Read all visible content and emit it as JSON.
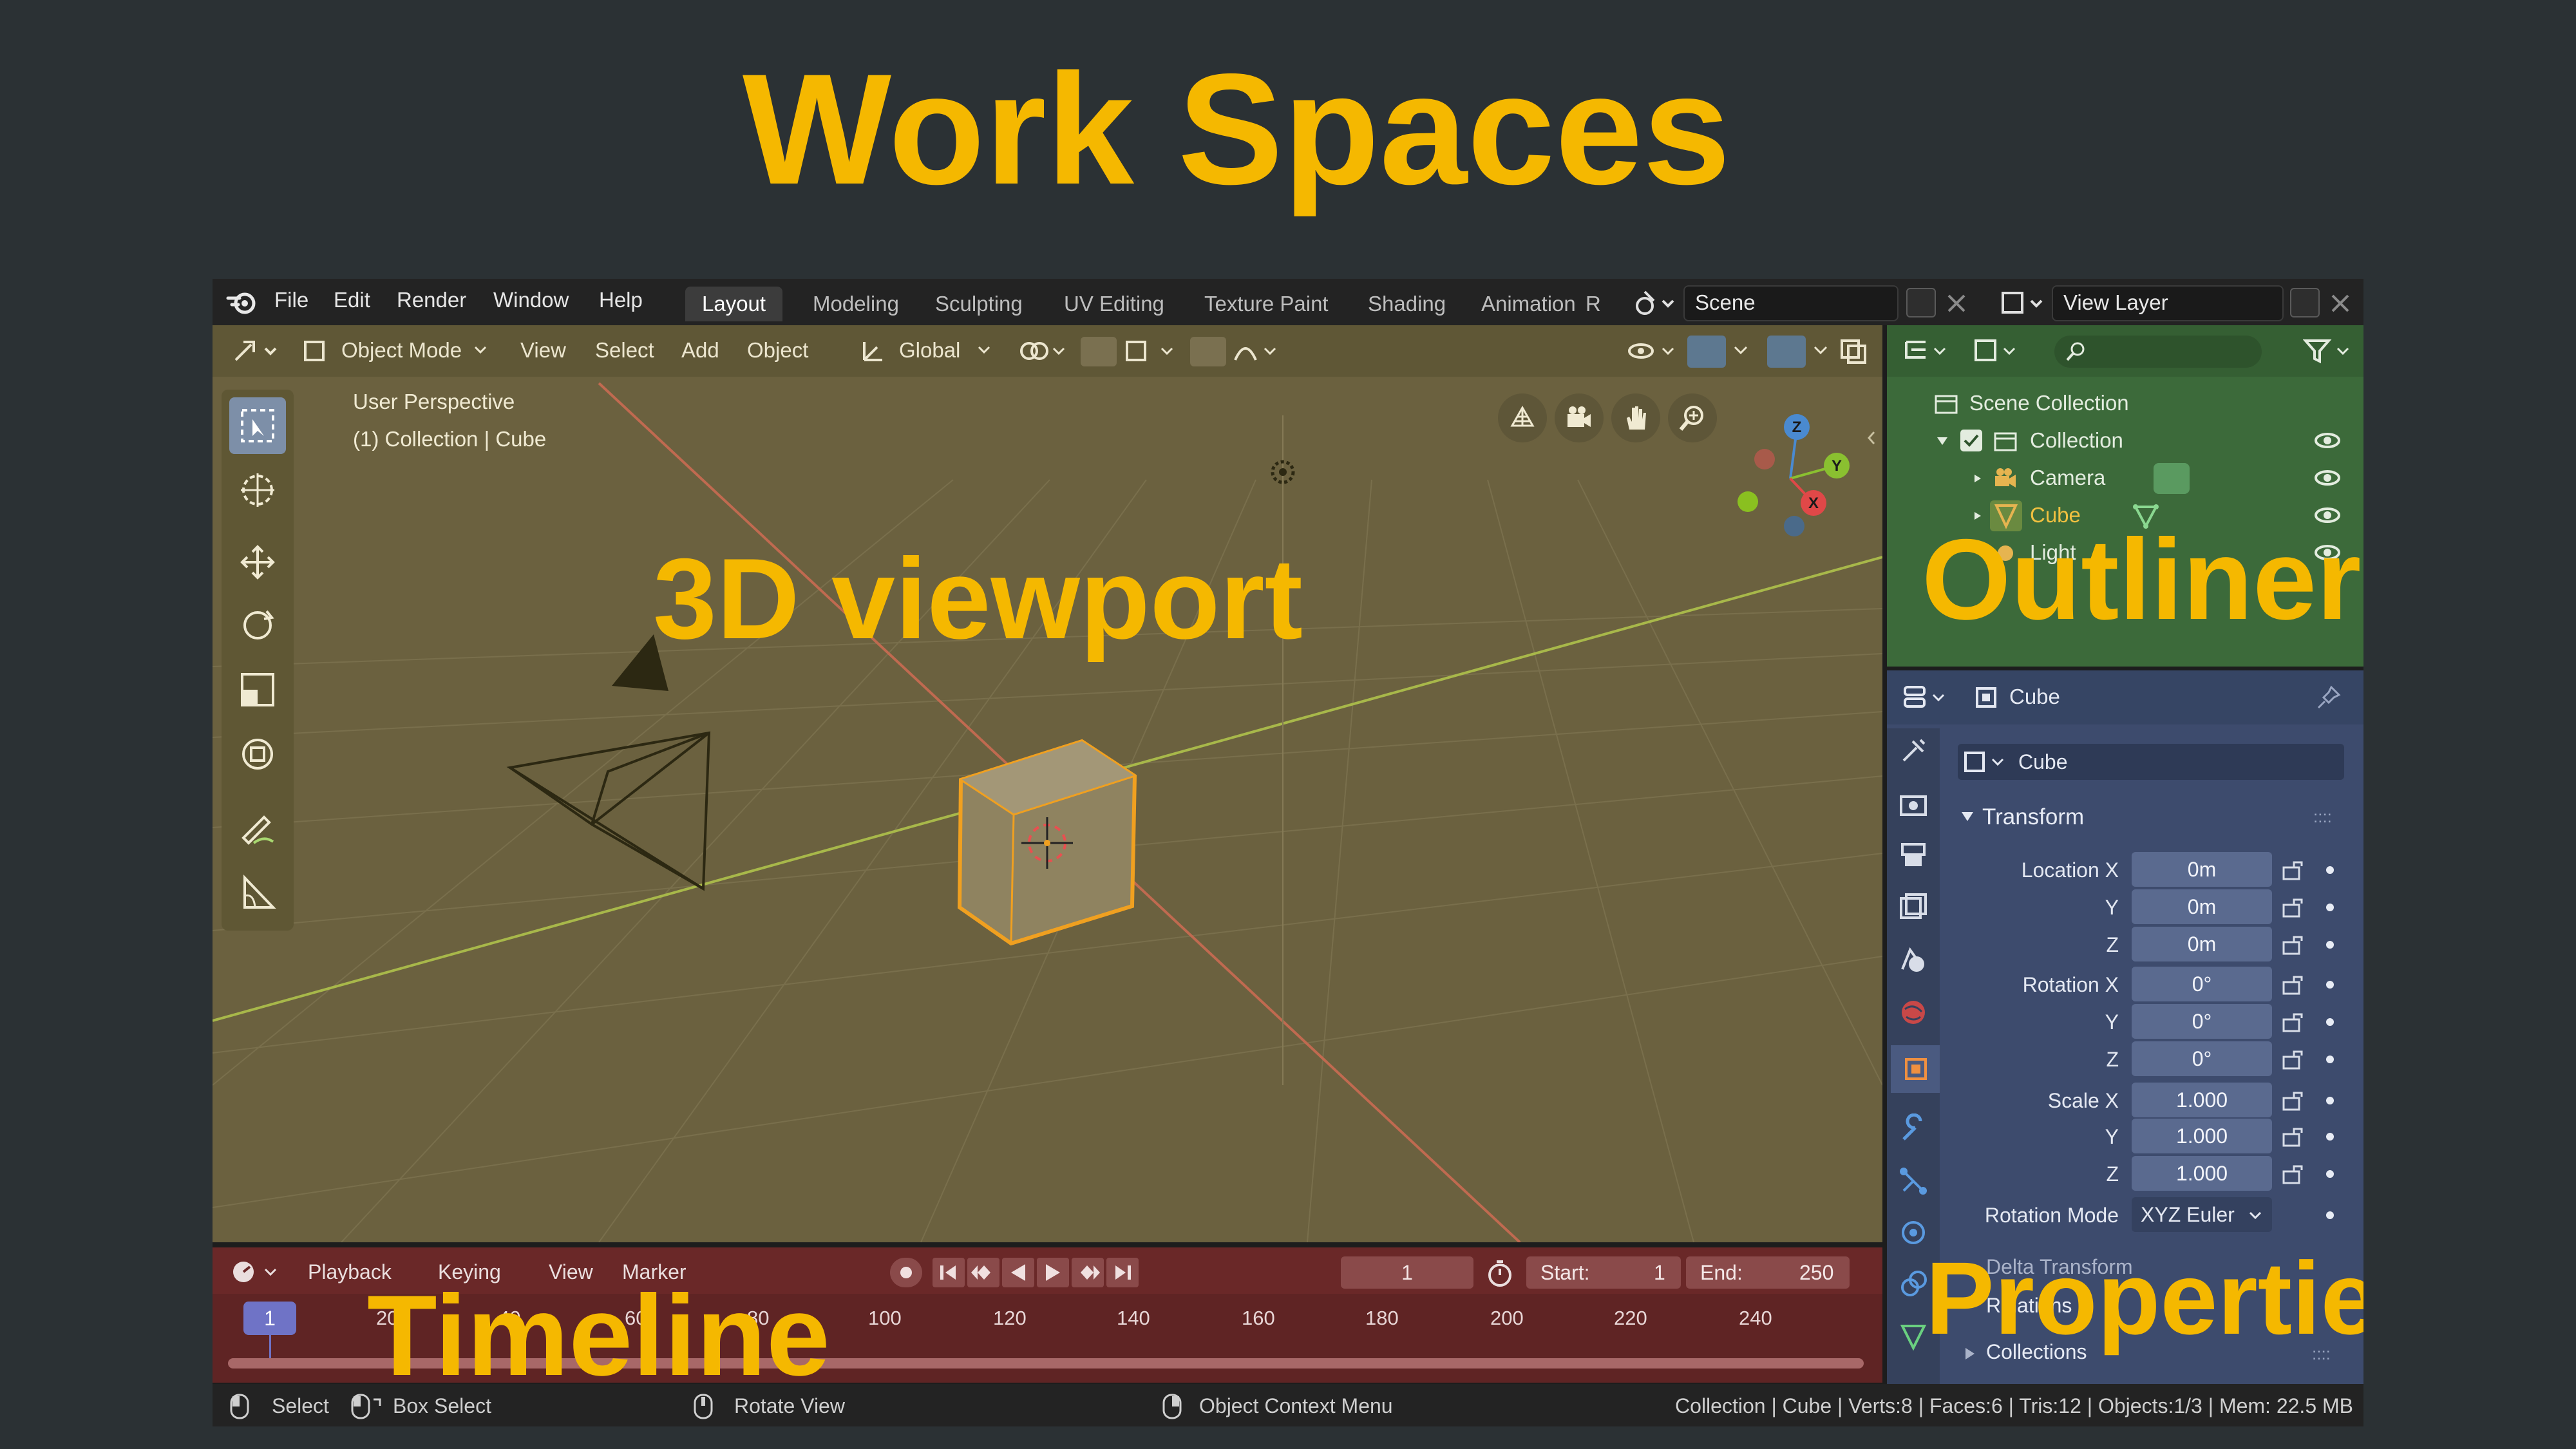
{
  "slide": {
    "title": "Work Spaces",
    "labels": {
      "viewport": "3D viewport",
      "outliner": "Outliner",
      "timeline": "Timeline",
      "properties": "Properties"
    }
  },
  "topbar": {
    "menus": [
      "File",
      "Edit",
      "Render",
      "Window",
      "Help"
    ],
    "workspace_tabs": [
      "Layout",
      "Modeling",
      "Sculpting",
      "UV Editing",
      "Texture Paint",
      "Shading",
      "Animation",
      "R"
    ],
    "active_tab": "Layout",
    "scene": "Scene",
    "view_layer": "View Layer"
  },
  "viewport": {
    "mode": "Object Mode",
    "menus": [
      "View",
      "Select",
      "Add",
      "Object"
    ],
    "orientation": "Global",
    "info_line1": "User Perspective",
    "info_line2": "(1) Collection | Cube",
    "gizmo": {
      "z": "Z",
      "y": "Y",
      "x": "X"
    }
  },
  "outliner": {
    "root": "Scene Collection",
    "collection": "Collection",
    "items": [
      "Camera",
      "Cube",
      "Light"
    ]
  },
  "properties": {
    "header_object": "Cube",
    "object_name": "Cube",
    "transform_title": "Transform",
    "location_label": "Location X",
    "rotation_label": "Rotation X",
    "scale_label": "Scale X",
    "axis_y": "Y",
    "axis_z": "Z",
    "location": [
      "0m",
      "0m",
      "0m"
    ],
    "rotation": [
      "0°",
      "0°",
      "0°"
    ],
    "scale": [
      "1.000",
      "1.000",
      "1.000"
    ],
    "rotation_mode_label": "Rotation Mode",
    "rotation_mode": "XYZ Euler",
    "delta_transform": "Delta Transform",
    "relations": "Relations",
    "collections": "Collections"
  },
  "timeline": {
    "menus": [
      "Playback",
      "Keying",
      "View",
      "Marker"
    ],
    "current_frame": "1",
    "start_label": "Start:",
    "start": "1",
    "end_label": "End:",
    "end": "250",
    "frame_badge": "1",
    "ruler": [
      "20",
      "40",
      "60",
      "80",
      "100",
      "120",
      "140",
      "160",
      "180",
      "200",
      "220",
      "240"
    ]
  },
  "statusbar": {
    "select": "Select",
    "box_select": "Box Select",
    "rotate_view": "Rotate View",
    "context_menu": "Object Context Menu",
    "stats": "Collection | Cube | Verts:8 | Faces:6 | Tris:12 | Objects:1/3 | Mem: 22.5 MB"
  },
  "colors": {
    "title": "#f5b800",
    "viewport_tint": "#6b613f",
    "outliner_tint": "#3c6a3a",
    "properties_tint": "#3d4b6d",
    "timeline_tint": "#5f2424",
    "selection_orange": "#f0a020"
  }
}
